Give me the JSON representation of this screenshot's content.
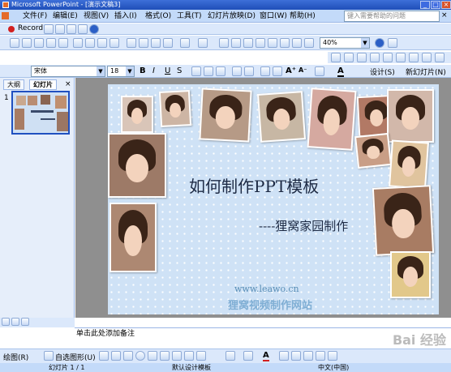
{
  "window": {
    "app_name": "Microsoft PowerPoint",
    "doc_title": "[演示文稿3]"
  },
  "menu": [
    "文件(F)",
    "编辑(E)",
    "视图(V)",
    "插入(I)",
    "格式(O)",
    "工具(T)",
    "幻灯片放映(D)",
    "窗口(W)",
    "帮助(H)"
  ],
  "help_placeholder": "键入需要帮助的问题",
  "record_label": "Record",
  "zoom": "40%",
  "font_name": "宋体",
  "font_size": "18",
  "format_buttons": {
    "bold": "B",
    "italic": "I",
    "underline": "U",
    "shadow": "S"
  },
  "design_label": "设计(S)",
  "new_slide_label": "新幻灯片(N)",
  "left_tabs": [
    "大纲",
    "幻灯片"
  ],
  "slide_number": "1",
  "slide": {
    "title": "如何制作PPT模板",
    "subtitle": "----狸窝家园制作",
    "url": "www.leawo.cn",
    "footer_brand": "狸窝视频制作网站"
  },
  "notes_placeholder": "单击此处添加备注",
  "draw_label": "绘图(R)",
  "autoshapes_label": "自选图形(U)",
  "status": {
    "slide_info": "幻灯片 1 / 1",
    "design": "默认设计模板",
    "language": "中文(中国)"
  },
  "watermark": "Bai 经验"
}
